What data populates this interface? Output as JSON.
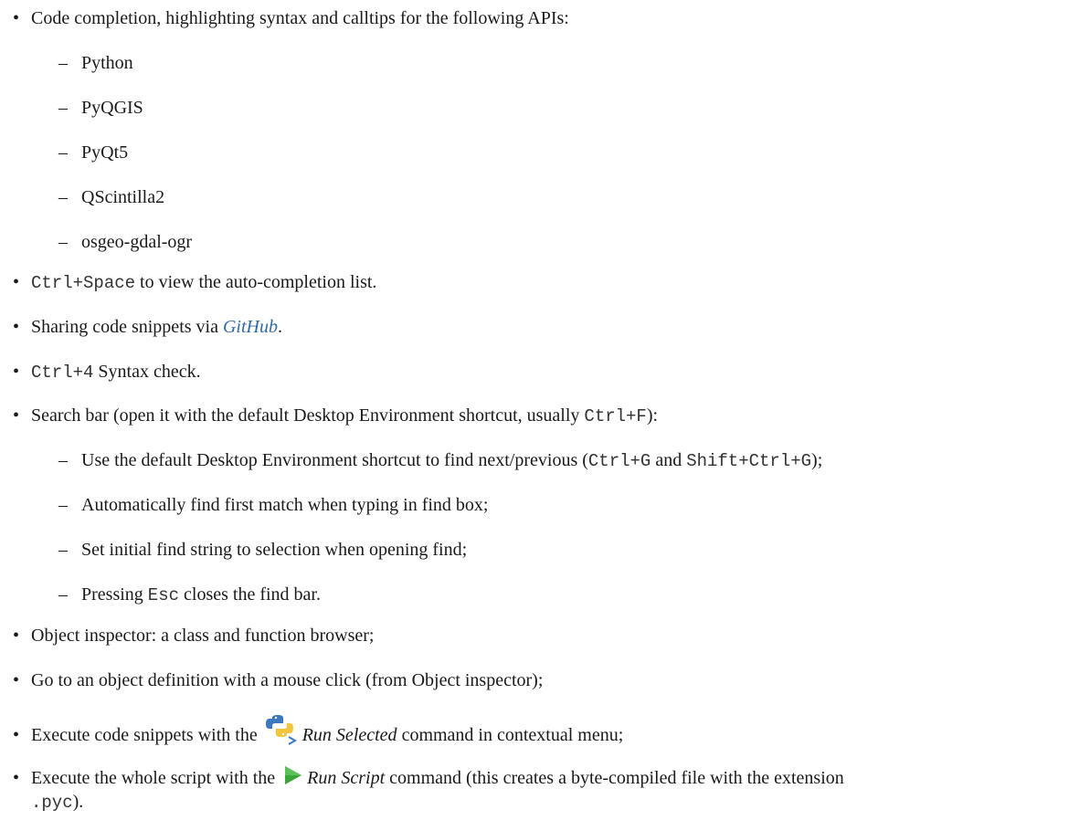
{
  "doc": {
    "bullet": "•",
    "dash": "–",
    "item_apis": "Code completion, highlighting syntax and calltips for the following APIs:",
    "apis": [
      "Python",
      "PyQGIS",
      "PyQt5",
      "QScintilla2",
      "osgeo-gdal-ogr"
    ],
    "ctrl_space": {
      "code": "Ctrl+Space",
      "text": " to view the auto-completion list."
    },
    "github": {
      "pre": "Sharing code snippets via ",
      "link": "GitHub",
      "post": "."
    },
    "ctrl4": {
      "code": "Ctrl+4",
      "text": " Syntax check."
    },
    "search": {
      "pre": "Search bar (open it with the default Desktop Environment shortcut, usually ",
      "code": "Ctrl+F",
      "post": "):"
    },
    "search_sub1": {
      "pre": "Use the default Desktop Environment shortcut to find next/previous (",
      "code1": "Ctrl+G",
      "mid": " and ",
      "code2": "Shift+Ctrl+G",
      "post": ");"
    },
    "search_sub2": "Automatically find first match when typing in find box;",
    "search_sub3": "Set initial find string to selection when opening find;",
    "search_sub4": {
      "pre": "Pressing ",
      "code": "Esc",
      "post": " closes the find bar."
    },
    "object_inspector": "Object inspector: a class and function browser;",
    "goto_def": "Go to an object definition with a mouse click (from Object inspector);",
    "run_selected": {
      "pre": "Execute code snippets with the ",
      "em": "Run Selected",
      "post": " command in contextual menu;"
    },
    "run_script": {
      "pre": "Execute the whole script with the ",
      "em": "Run Script",
      "post": " command (this creates a byte-compiled file with the extension",
      "code": ".pyc",
      "end": ")."
    }
  },
  "icons": {
    "python_run": "python-run-selected-icon",
    "run_script": "run-script-play-icon"
  },
  "colors": {
    "link": "#2f6ba8",
    "text": "#1a1a1a",
    "run_green": "#3aa63a",
    "python_blue": "#3b78c0",
    "python_yellow": "#f2c53d"
  }
}
